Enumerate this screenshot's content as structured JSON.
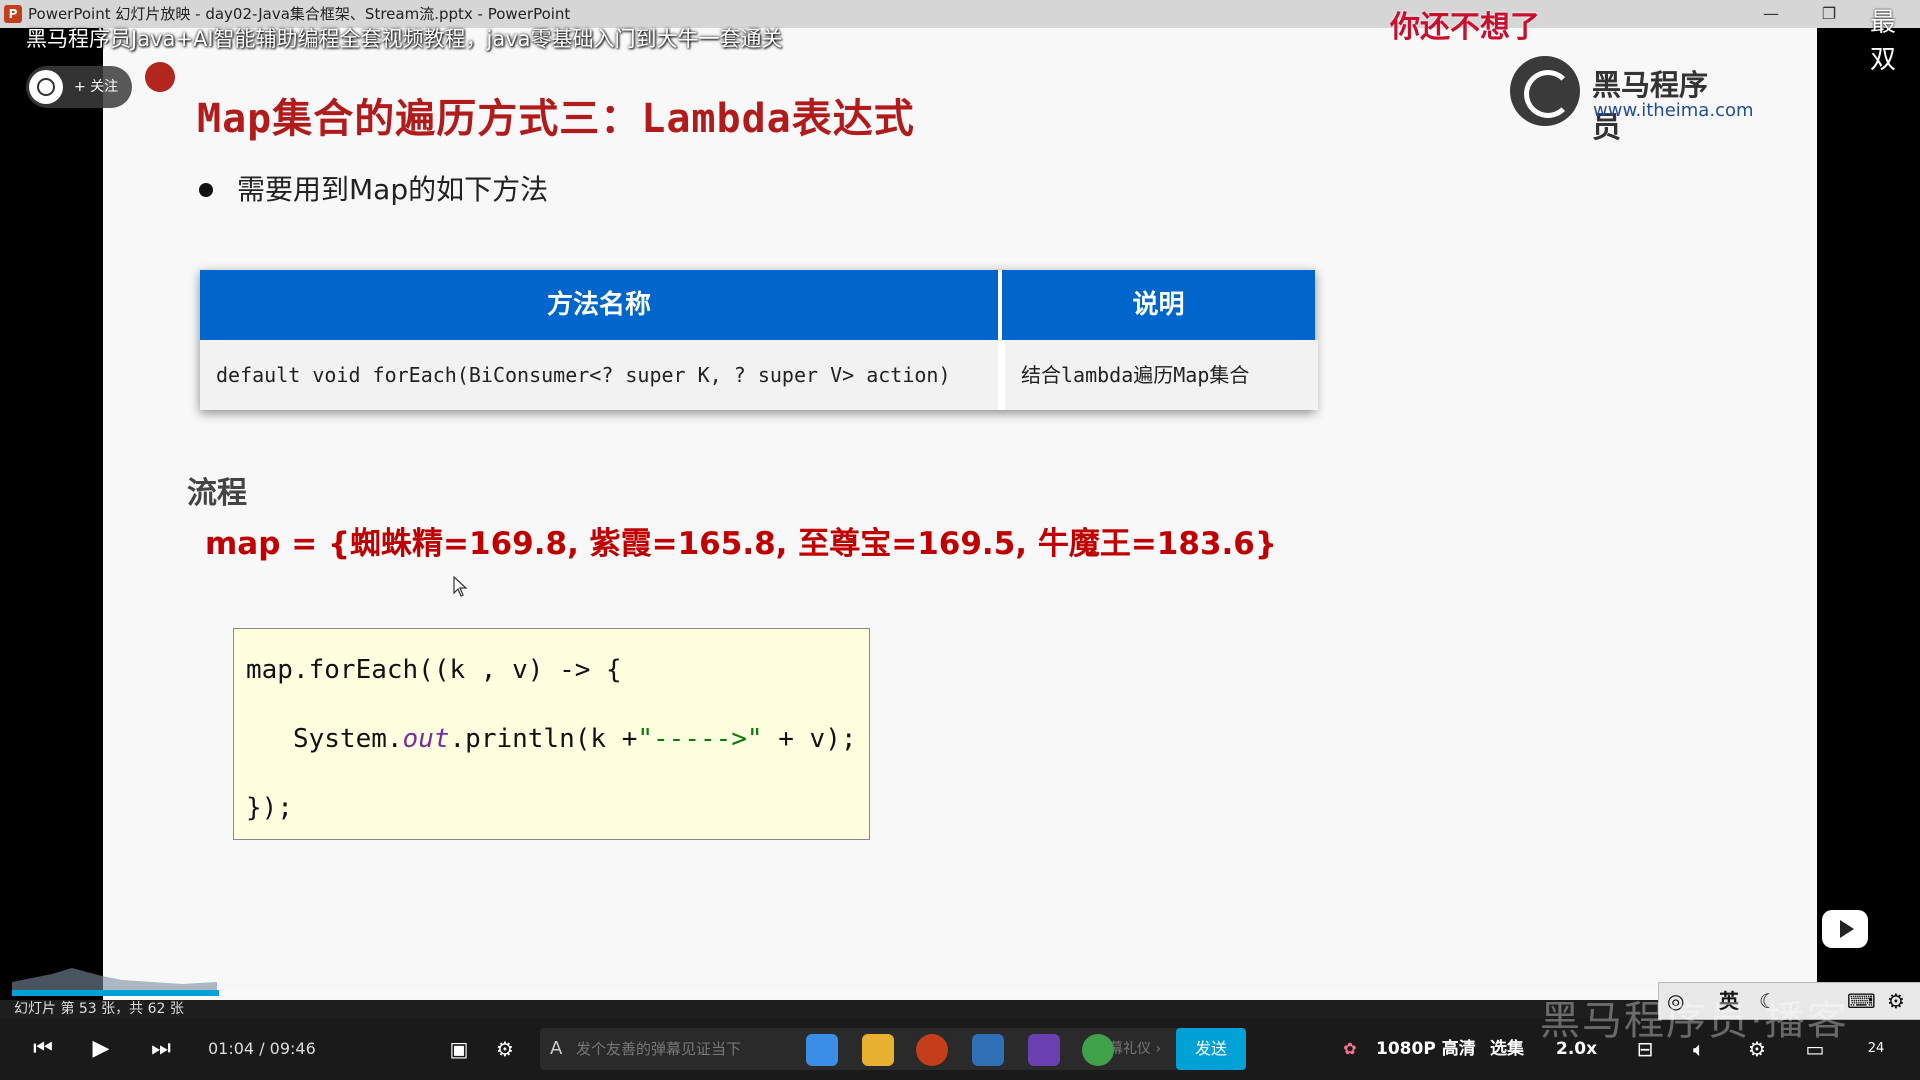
{
  "window": {
    "app_icon": "P",
    "title": "PowerPoint 幻灯片放映  -  day02-Java集合框架、Stream流.pptx - PowerPoint",
    "minimize": "—",
    "restore": "❐"
  },
  "overlay": {
    "video_title": "黑马程序员Java+AI智能辅助编程全套视频教程，java零基础入门到大牛一套通关",
    "danmaku_top": "你还不想了",
    "corner_text": "最双",
    "follow_label": "+ 关注"
  },
  "slide": {
    "title": "Map集合的遍历方式三：Lambda表达式",
    "logo": {
      "name": "黑马程序员",
      "url": "www.itheima.com"
    },
    "bullet": "需要用到Map的如下方法",
    "table": {
      "headers": [
        "方法名称",
        "说明"
      ],
      "rows": [
        [
          "default void forEach(BiConsumer<? super K, ? super V> action)",
          "结合lambda遍历Map集合"
        ]
      ]
    },
    "section_label": "流程",
    "map_line": "map = {蜘蛛精=169.8, 紫霞=165.8, 至尊宝=169.5, 牛魔王=183.6}",
    "code": {
      "line1": "map.forEach((k , v) -> {",
      "line2_a": "   System.",
      "line2_b": "out",
      "line2_c": ".println(k +",
      "line2_d": "\"----->\"",
      "line2_e": " + v);",
      "line3": "});"
    }
  },
  "player": {
    "status": "幻灯片 第 53 张，共 62 张",
    "current_time": "01:04",
    "total_time": "09:46",
    "time_sep": " / ",
    "progress": 0.109,
    "danmaku_placeholder": "发个友善的弹幕见证当下",
    "danmaku_etiquette": "弹幕礼仪 ›",
    "send": "发送",
    "quality": "1080P 高清",
    "episodes": "选集",
    "speed": "2.0x",
    "ime_lang": "英",
    "watermark": "黑马程序员·播客",
    "tray_date": "24",
    "colors": {
      "accent": "#00a1d6",
      "title_red": "#b21b1b",
      "header_blue": "#0066cc"
    }
  }
}
